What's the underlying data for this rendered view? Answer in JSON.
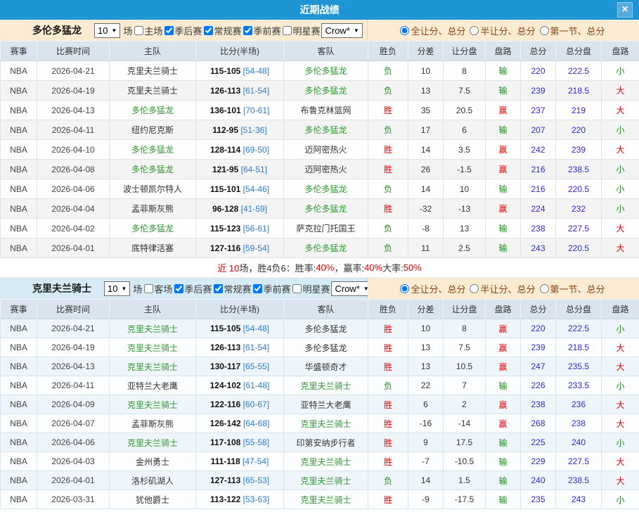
{
  "colors": {
    "header_blue": "#1E95D5",
    "filter_cream": "#FAEBD2",
    "filter_blue": "#D6EBF5",
    "table_head_blue": "#D9E4EE",
    "win_red": "#E60000",
    "lose_green": "#1E8C1E",
    "team_green": "#2D9A2D",
    "total_blue": "#2A2AD4",
    "halftime_blue": "#2E7CD0"
  },
  "dialog": {
    "title": "近期战绩",
    "close_icon": "×"
  },
  "columns": [
    "赛事",
    "比赛时间",
    "主队",
    "比分(半场)",
    "客队",
    "胜负",
    "分差",
    "让分盘",
    "盘路",
    "总分",
    "总分盘",
    "盘路"
  ],
  "sections": [
    {
      "team": "多伦多猛龙",
      "filters": {
        "count_value": "10",
        "count_suffix": "场",
        "checkboxes": [
          {
            "label": "主场",
            "checked": false
          },
          {
            "label": "季后赛",
            "checked": true
          },
          {
            "label": "常规赛",
            "checked": true
          },
          {
            "label": "季前赛",
            "checked": true
          },
          {
            "label": "明星赛",
            "checked": false
          }
        ],
        "source_value": "Crow*",
        "radios": [
          {
            "label": "全让分、总分",
            "selected": true
          },
          {
            "label": "半让分、总分",
            "selected": false
          },
          {
            "label": "第一节、总分",
            "selected": false
          }
        ]
      },
      "rows": [
        {
          "league": "NBA",
          "date": "2026-04-21",
          "home": "克里夫兰骑士",
          "score": "115-105",
          "half": "[54-48]",
          "away": "多伦多猛龙",
          "result": "负",
          "diff": "10",
          "handicap": "8",
          "handicap_result": "输",
          "total": "220",
          "total_line": "222.5",
          "total_result": "小"
        },
        {
          "league": "NBA",
          "date": "2026-04-19",
          "home": "克里夫兰骑士",
          "score": "126-113",
          "half": "[61-54]",
          "away": "多伦多猛龙",
          "result": "负",
          "diff": "13",
          "handicap": "7.5",
          "handicap_result": "输",
          "total": "239",
          "total_line": "218.5",
          "total_result": "大"
        },
        {
          "league": "NBA",
          "date": "2026-04-13",
          "home": "多伦多猛龙",
          "score": "136-101",
          "half": "[70-61]",
          "away": "布鲁克林篮网",
          "result": "胜",
          "diff": "35",
          "handicap": "20.5",
          "handicap_result": "赢",
          "total": "237",
          "total_line": "219",
          "total_result": "大"
        },
        {
          "league": "NBA",
          "date": "2026-04-11",
          "home": "纽约尼克斯",
          "score": "112-95",
          "half": "[51-36]",
          "away": "多伦多猛龙",
          "result": "负",
          "diff": "17",
          "handicap": "6",
          "handicap_result": "输",
          "total": "207",
          "total_line": "220",
          "total_result": "小"
        },
        {
          "league": "NBA",
          "date": "2026-04-10",
          "home": "多伦多猛龙",
          "score": "128-114",
          "half": "[69-50]",
          "away": "迈阿密热火",
          "result": "胜",
          "diff": "14",
          "handicap": "3.5",
          "handicap_result": "赢",
          "total": "242",
          "total_line": "239",
          "total_result": "大"
        },
        {
          "league": "NBA",
          "date": "2026-04-08",
          "home": "多伦多猛龙",
          "score": "121-95",
          "half": "[64-51]",
          "away": "迈阿密热火",
          "result": "胜",
          "diff": "26",
          "handicap": "-1.5",
          "handicap_result": "赢",
          "total": "216",
          "total_line": "238.5",
          "total_result": "小"
        },
        {
          "league": "NBA",
          "date": "2026-04-06",
          "home": "波士顿凯尔特人",
          "score": "115-101",
          "half": "[54-46]",
          "away": "多伦多猛龙",
          "result": "负",
          "diff": "14",
          "handicap": "10",
          "handicap_result": "输",
          "total": "216",
          "total_line": "220.5",
          "total_result": "小"
        },
        {
          "league": "NBA",
          "date": "2026-04-04",
          "home": "孟菲斯灰熊",
          "score": "96-128",
          "half": "[41-59]",
          "away": "多伦多猛龙",
          "result": "胜",
          "diff": "-32",
          "handicap": "-13",
          "handicap_result": "赢",
          "total": "224",
          "total_line": "232",
          "total_result": "小"
        },
        {
          "league": "NBA",
          "date": "2026-04-02",
          "home": "多伦多猛龙",
          "score": "115-123",
          "half": "[56-61]",
          "away": "萨克拉门托国王",
          "result": "负",
          "diff": "-8",
          "handicap": "13",
          "handicap_result": "输",
          "total": "238",
          "total_line": "227.5",
          "total_result": "大"
        },
        {
          "league": "NBA",
          "date": "2026-04-01",
          "home": "底特律活塞",
          "score": "127-116",
          "half": "[59-54]",
          "away": "多伦多猛龙",
          "result": "负",
          "diff": "11",
          "handicap": "2.5",
          "handicap_result": "输",
          "total": "243",
          "total_line": "220.5",
          "total_result": "大"
        }
      ],
      "summary_parts": [
        {
          "text": "近 10",
          "red": true
        },
        {
          "text": " 场，胜4负6：胜率: ",
          "red": false
        },
        {
          "text": "40%",
          "red": true
        },
        {
          "text": "，赢率: ",
          "red": false
        },
        {
          "text": "40%",
          "red": true
        },
        {
          "text": " 大率: ",
          "red": false
        },
        {
          "text": "50%",
          "red": true
        }
      ]
    },
    {
      "team": "克里夫兰骑士",
      "filters": {
        "count_value": "10",
        "count_suffix": "场",
        "checkboxes": [
          {
            "label": "客场",
            "checked": false
          },
          {
            "label": "季后赛",
            "checked": true
          },
          {
            "label": "常规赛",
            "checked": true
          },
          {
            "label": "季前赛",
            "checked": true
          },
          {
            "label": "明星赛",
            "checked": false
          }
        ],
        "source_value": "Crow*",
        "radios": [
          {
            "label": "全让分、总分",
            "selected": true
          },
          {
            "label": "半让分、总分",
            "selected": false
          },
          {
            "label": "第一节、总分",
            "selected": false
          }
        ]
      },
      "rows": [
        {
          "league": "NBA",
          "date": "2026-04-21",
          "home": "克里夫兰骑士",
          "score": "115-105",
          "half": "[54-48]",
          "away": "多伦多猛龙",
          "result": "胜",
          "diff": "10",
          "handicap": "8",
          "handicap_result": "赢",
          "total": "220",
          "total_line": "222.5",
          "total_result": "小"
        },
        {
          "league": "NBA",
          "date": "2026-04-19",
          "home": "克里夫兰骑士",
          "score": "126-113",
          "half": "[61-54]",
          "away": "多伦多猛龙",
          "result": "胜",
          "diff": "13",
          "handicap": "7.5",
          "handicap_result": "赢",
          "total": "239",
          "total_line": "218.5",
          "total_result": "大"
        },
        {
          "league": "NBA",
          "date": "2026-04-13",
          "home": "克里夫兰骑士",
          "score": "130-117",
          "half": "[65-55]",
          "away": "华盛顿奇才",
          "result": "胜",
          "diff": "13",
          "handicap": "10.5",
          "handicap_result": "赢",
          "total": "247",
          "total_line": "235.5",
          "total_result": "大"
        },
        {
          "league": "NBA",
          "date": "2026-04-11",
          "home": "亚特兰大老鹰",
          "score": "124-102",
          "half": "[61-48]",
          "away": "克里夫兰骑士",
          "result": "负",
          "diff": "22",
          "handicap": "7",
          "handicap_result": "输",
          "total": "226",
          "total_line": "233.5",
          "total_result": "小"
        },
        {
          "league": "NBA",
          "date": "2026-04-09",
          "home": "克里夫兰骑士",
          "score": "122-116",
          "half": "[60-67]",
          "away": "亚特兰大老鹰",
          "result": "胜",
          "diff": "6",
          "handicap": "2",
          "handicap_result": "赢",
          "total": "238",
          "total_line": "236",
          "total_result": "大"
        },
        {
          "league": "NBA",
          "date": "2026-04-07",
          "home": "孟菲斯灰熊",
          "score": "126-142",
          "half": "[64-68]",
          "away": "克里夫兰骑士",
          "result": "胜",
          "diff": "-16",
          "handicap": "-14",
          "handicap_result": "赢",
          "total": "268",
          "total_line": "238",
          "total_result": "大"
        },
        {
          "league": "NBA",
          "date": "2026-04-06",
          "home": "克里夫兰骑士",
          "score": "117-108",
          "half": "[55-58]",
          "away": "印第安纳步行者",
          "result": "胜",
          "diff": "9",
          "handicap": "17.5",
          "handicap_result": "输",
          "total": "225",
          "total_line": "240",
          "total_result": "小"
        },
        {
          "league": "NBA",
          "date": "2026-04-03",
          "home": "金州勇士",
          "score": "111-118",
          "half": "[47-54]",
          "away": "克里夫兰骑士",
          "result": "胜",
          "diff": "-7",
          "handicap": "-10.5",
          "handicap_result": "输",
          "total": "229",
          "total_line": "227.5",
          "total_result": "大"
        },
        {
          "league": "NBA",
          "date": "2026-04-01",
          "home": "洛杉矶湖人",
          "score": "127-113",
          "half": "[65-53]",
          "away": "克里夫兰骑士",
          "result": "负",
          "diff": "14",
          "handicap": "1.5",
          "handicap_result": "输",
          "total": "240",
          "total_line": "238.5",
          "total_result": "大"
        },
        {
          "league": "NBA",
          "date": "2026-03-31",
          "home": "犹他爵士",
          "score": "113-122",
          "half": "[53-63]",
          "away": "克里夫兰骑士",
          "result": "胜",
          "diff": "-9",
          "handicap": "-17.5",
          "handicap_result": "输",
          "total": "235",
          "total_line": "243",
          "total_result": "小"
        }
      ],
      "summary_parts": []
    }
  ]
}
